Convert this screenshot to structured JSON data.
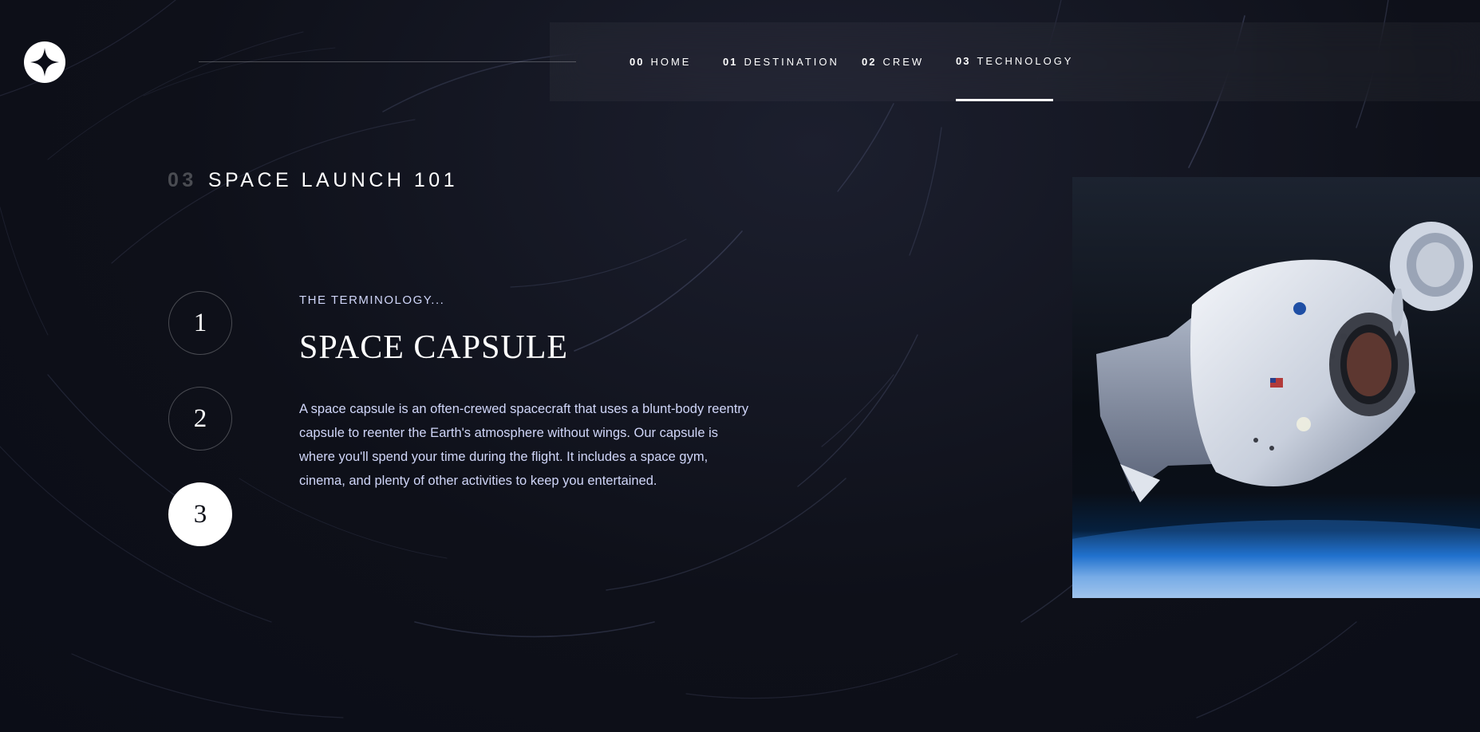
{
  "logo": {
    "icon": "star-icon"
  },
  "nav": {
    "items": [
      {
        "num": "00",
        "label": "HOME",
        "active": false
      },
      {
        "num": "01",
        "label": "DESTINATION",
        "active": false
      },
      {
        "num": "02",
        "label": "CREW",
        "active": false
      },
      {
        "num": "03",
        "label": "TECHNOLOGY",
        "active": true
      }
    ]
  },
  "page": {
    "eyebrow_num": "03",
    "eyebrow_text": "SPACE LAUNCH 101"
  },
  "steps": [
    {
      "label": "1",
      "active": false
    },
    {
      "label": "2",
      "active": false
    },
    {
      "label": "3",
      "active": true
    }
  ],
  "technology": {
    "kicker": "THE TERMINOLOGY...",
    "title": "SPACE CAPSULE",
    "description": "A space capsule is an often-crewed spacecraft that uses a blunt-body reentry capsule to reenter the Earth's atmosphere without wings. Our capsule is where you'll spend your time during the flight. It includes a space gym, cinema, and plenty of other activities to keep you entertained."
  },
  "colors": {
    "background": "#0b0d17",
    "text_light": "#d0d6f9",
    "white": "#ffffff",
    "earth_blue": "#1b6bc4"
  }
}
